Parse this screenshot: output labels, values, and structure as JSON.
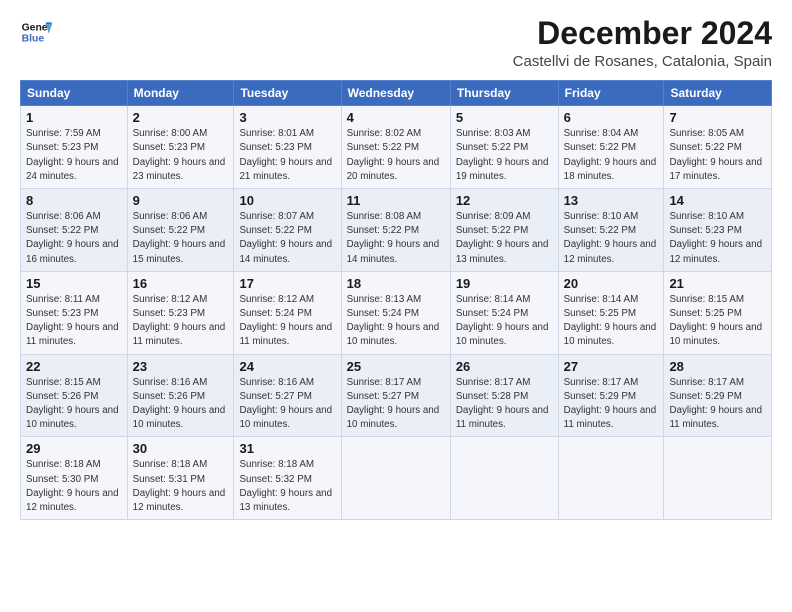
{
  "logo": {
    "line1": "General",
    "line2": "Blue"
  },
  "title": "December 2024",
  "subtitle": "Castellvi de Rosanes, Catalonia, Spain",
  "weekdays": [
    "Sunday",
    "Monday",
    "Tuesday",
    "Wednesday",
    "Thursday",
    "Friday",
    "Saturday"
  ],
  "weeks": [
    [
      {
        "day": "1",
        "rise": "Sunrise: 7:59 AM",
        "set": "Sunset: 5:23 PM",
        "daylight": "Daylight: 9 hours and 24 minutes."
      },
      {
        "day": "2",
        "rise": "Sunrise: 8:00 AM",
        "set": "Sunset: 5:23 PM",
        "daylight": "Daylight: 9 hours and 23 minutes."
      },
      {
        "day": "3",
        "rise": "Sunrise: 8:01 AM",
        "set": "Sunset: 5:23 PM",
        "daylight": "Daylight: 9 hours and 21 minutes."
      },
      {
        "day": "4",
        "rise": "Sunrise: 8:02 AM",
        "set": "Sunset: 5:22 PM",
        "daylight": "Daylight: 9 hours and 20 minutes."
      },
      {
        "day": "5",
        "rise": "Sunrise: 8:03 AM",
        "set": "Sunset: 5:22 PM",
        "daylight": "Daylight: 9 hours and 19 minutes."
      },
      {
        "day": "6",
        "rise": "Sunrise: 8:04 AM",
        "set": "Sunset: 5:22 PM",
        "daylight": "Daylight: 9 hours and 18 minutes."
      },
      {
        "day": "7",
        "rise": "Sunrise: 8:05 AM",
        "set": "Sunset: 5:22 PM",
        "daylight": "Daylight: 9 hours and 17 minutes."
      }
    ],
    [
      {
        "day": "8",
        "rise": "Sunrise: 8:06 AM",
        "set": "Sunset: 5:22 PM",
        "daylight": "Daylight: 9 hours and 16 minutes."
      },
      {
        "day": "9",
        "rise": "Sunrise: 8:06 AM",
        "set": "Sunset: 5:22 PM",
        "daylight": "Daylight: 9 hours and 15 minutes."
      },
      {
        "day": "10",
        "rise": "Sunrise: 8:07 AM",
        "set": "Sunset: 5:22 PM",
        "daylight": "Daylight: 9 hours and 14 minutes."
      },
      {
        "day": "11",
        "rise": "Sunrise: 8:08 AM",
        "set": "Sunset: 5:22 PM",
        "daylight": "Daylight: 9 hours and 14 minutes."
      },
      {
        "day": "12",
        "rise": "Sunrise: 8:09 AM",
        "set": "Sunset: 5:22 PM",
        "daylight": "Daylight: 9 hours and 13 minutes."
      },
      {
        "day": "13",
        "rise": "Sunrise: 8:10 AM",
        "set": "Sunset: 5:22 PM",
        "daylight": "Daylight: 9 hours and 12 minutes."
      },
      {
        "day": "14",
        "rise": "Sunrise: 8:10 AM",
        "set": "Sunset: 5:23 PM",
        "daylight": "Daylight: 9 hours and 12 minutes."
      }
    ],
    [
      {
        "day": "15",
        "rise": "Sunrise: 8:11 AM",
        "set": "Sunset: 5:23 PM",
        "daylight": "Daylight: 9 hours and 11 minutes."
      },
      {
        "day": "16",
        "rise": "Sunrise: 8:12 AM",
        "set": "Sunset: 5:23 PM",
        "daylight": "Daylight: 9 hours and 11 minutes."
      },
      {
        "day": "17",
        "rise": "Sunrise: 8:12 AM",
        "set": "Sunset: 5:24 PM",
        "daylight": "Daylight: 9 hours and 11 minutes."
      },
      {
        "day": "18",
        "rise": "Sunrise: 8:13 AM",
        "set": "Sunset: 5:24 PM",
        "daylight": "Daylight: 9 hours and 10 minutes."
      },
      {
        "day": "19",
        "rise": "Sunrise: 8:14 AM",
        "set": "Sunset: 5:24 PM",
        "daylight": "Daylight: 9 hours and 10 minutes."
      },
      {
        "day": "20",
        "rise": "Sunrise: 8:14 AM",
        "set": "Sunset: 5:25 PM",
        "daylight": "Daylight: 9 hours and 10 minutes."
      },
      {
        "day": "21",
        "rise": "Sunrise: 8:15 AM",
        "set": "Sunset: 5:25 PM",
        "daylight": "Daylight: 9 hours and 10 minutes."
      }
    ],
    [
      {
        "day": "22",
        "rise": "Sunrise: 8:15 AM",
        "set": "Sunset: 5:26 PM",
        "daylight": "Daylight: 9 hours and 10 minutes."
      },
      {
        "day": "23",
        "rise": "Sunrise: 8:16 AM",
        "set": "Sunset: 5:26 PM",
        "daylight": "Daylight: 9 hours and 10 minutes."
      },
      {
        "day": "24",
        "rise": "Sunrise: 8:16 AM",
        "set": "Sunset: 5:27 PM",
        "daylight": "Daylight: 9 hours and 10 minutes."
      },
      {
        "day": "25",
        "rise": "Sunrise: 8:17 AM",
        "set": "Sunset: 5:27 PM",
        "daylight": "Daylight: 9 hours and 10 minutes."
      },
      {
        "day": "26",
        "rise": "Sunrise: 8:17 AM",
        "set": "Sunset: 5:28 PM",
        "daylight": "Daylight: 9 hours and 11 minutes."
      },
      {
        "day": "27",
        "rise": "Sunrise: 8:17 AM",
        "set": "Sunset: 5:29 PM",
        "daylight": "Daylight: 9 hours and 11 minutes."
      },
      {
        "day": "28",
        "rise": "Sunrise: 8:17 AM",
        "set": "Sunset: 5:29 PM",
        "daylight": "Daylight: 9 hours and 11 minutes."
      }
    ],
    [
      {
        "day": "29",
        "rise": "Sunrise: 8:18 AM",
        "set": "Sunset: 5:30 PM",
        "daylight": "Daylight: 9 hours and 12 minutes."
      },
      {
        "day": "30",
        "rise": "Sunrise: 8:18 AM",
        "set": "Sunset: 5:31 PM",
        "daylight": "Daylight: 9 hours and 12 minutes."
      },
      {
        "day": "31",
        "rise": "Sunrise: 8:18 AM",
        "set": "Sunset: 5:32 PM",
        "daylight": "Daylight: 9 hours and 13 minutes."
      },
      null,
      null,
      null,
      null
    ]
  ]
}
